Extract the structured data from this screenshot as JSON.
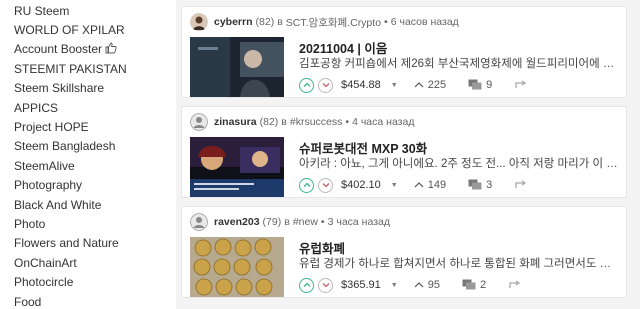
{
  "sidebar": {
    "items": [
      {
        "label": "RU Steem"
      },
      {
        "label": "WORLD OF XPILAR"
      },
      {
        "label": "Account Booster",
        "icon": "thumbs-up-icon"
      },
      {
        "label": "STEEMIT PAKISTAN"
      },
      {
        "label": "Steem Skillshare"
      },
      {
        "label": "APPICS"
      },
      {
        "label": "Project HOPE"
      },
      {
        "label": "Steem Bangladesh"
      },
      {
        "label": "SteemAlive"
      },
      {
        "label": "Photography"
      },
      {
        "label": "Black And White"
      },
      {
        "label": "Photo"
      },
      {
        "label": "Flowers and Nature"
      },
      {
        "label": "OnChainArt"
      },
      {
        "label": "Photocircle"
      },
      {
        "label": "Food"
      }
    ]
  },
  "feed": {
    "posts": [
      {
        "author": "cyberrn",
        "reputation": "(82)",
        "in_label": "в",
        "category": "SCT.암호화폐.Crypto",
        "separator": "•",
        "time": "6 часов назад",
        "title": "20211004 | 이음",
        "excerpt": "김포공항 커피숍에서 제26회 부산국제영화제에 월드피리미어에 초...",
        "payout": "$454.88",
        "votes": "225",
        "comments": "9"
      },
      {
        "author": "zinasura",
        "reputation": "(82)",
        "in_label": "в",
        "category": "#krsuccess",
        "separator": "•",
        "time": "4 часа назад",
        "title": "슈퍼로봇대전 MXP 30화",
        "excerpt": "아키라 : 아뇨, 그게 아니에요. 2주 정도 전... 아직 저랑 마리가 이 부...",
        "payout": "$402.10",
        "votes": "149",
        "comments": "3"
      },
      {
        "author": "raven203",
        "reputation": "(79)",
        "in_label": "в",
        "category": "#new",
        "separator": "•",
        "time": "3 часа назад",
        "title": "유럽화폐",
        "excerpt": "유럽 경제가 하나로 합쳐지면서 하나로 통합된 화폐 그러면서도 개...",
        "payout": "$365.91",
        "votes": "95",
        "comments": "2"
      }
    ]
  },
  "colors": {
    "upvote_accent": "#3ab58e",
    "downvote": "#b9b9b9",
    "page_bg": "#f4f4f4"
  }
}
